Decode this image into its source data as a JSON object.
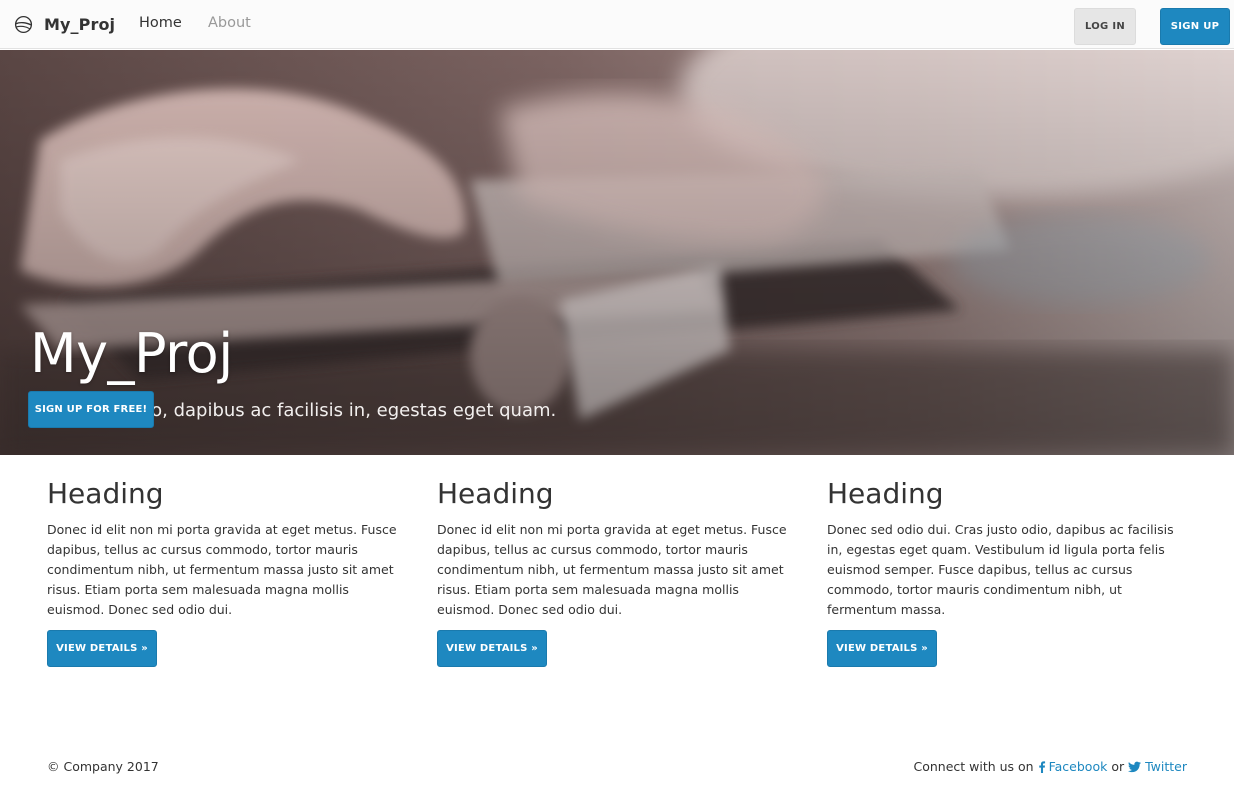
{
  "navbar": {
    "brand": "My_Proj",
    "links": [
      {
        "label": "Home"
      },
      {
        "label": "About"
      }
    ],
    "login_label": "LOG IN",
    "signup_label": "SIGN UP"
  },
  "hero": {
    "title": "My_Proj",
    "subtitle": "Cras justo odio, dapibus ac facilisis in, egestas eget quam.",
    "cta_label": "SIGN UP FOR FREE!"
  },
  "columns": [
    {
      "heading": "Heading",
      "body": "Donec id elit non mi porta gravida at eget metus. Fusce dapibus, tellus ac cursus commodo, tortor mauris condimentum nibh, ut fermentum massa justo sit amet risus. Etiam porta sem malesuada magna mollis euismod. Donec sed odio dui.",
      "button": "VIEW DETAILS »"
    },
    {
      "heading": "Heading",
      "body": "Donec id elit non mi porta gravida at eget metus. Fusce dapibus, tellus ac cursus commodo, tortor mauris condimentum nibh, ut fermentum massa justo sit amet risus. Etiam porta sem malesuada magna mollis euismod. Donec sed odio dui.",
      "button": "VIEW DETAILS »"
    },
    {
      "heading": "Heading",
      "body": "Donec sed odio dui. Cras justo odio, dapibus ac facilisis in, egestas eget quam. Vestibulum id ligula porta felis euismod semper. Fusce dapibus, tellus ac cursus commodo, tortor mauris condimentum nibh, ut fermentum massa.",
      "button": "VIEW DETAILS »"
    }
  ],
  "footer": {
    "copyright": "© Company 2017",
    "connect_text": "Connect with us on",
    "facebook_label": "Facebook",
    "or_text": "or",
    "twitter_label": "Twitter"
  },
  "colors": {
    "accent": "#1e88c0",
    "navbar_bg": "#fbfbfb",
    "login_bg": "#e6e6e6",
    "muted_link": "#999999",
    "text": "#333333"
  },
  "icons": {
    "brand": "globe-icon",
    "facebook": "facebook-icon",
    "twitter": "twitter-icon"
  }
}
